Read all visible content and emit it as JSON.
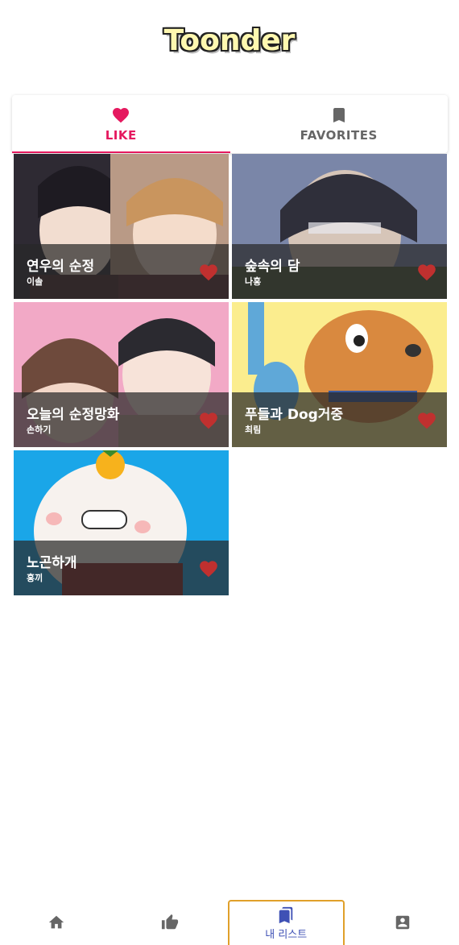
{
  "app": {
    "logo_text": "Toonder"
  },
  "tabs": [
    {
      "label": "LIKE",
      "icon": "heart-icon",
      "active": true
    },
    {
      "label": "FAVORITES",
      "icon": "bookmark-icon",
      "active": false
    }
  ],
  "colors": {
    "accent": "#e5195f",
    "heart": "#c0302f",
    "nav_active": "#3f51b5",
    "nav_border": "#e0a02a"
  },
  "cards": [
    {
      "title": "연우의 순정",
      "author": "이솔",
      "liked": true
    },
    {
      "title": "숲속의 담",
      "author": "나홍",
      "liked": true
    },
    {
      "title": "오늘의 순정망화",
      "author": "손하기",
      "liked": true
    },
    {
      "title": "푸들과 Dog거중",
      "author": "최림",
      "liked": true
    },
    {
      "title": "노곤하개",
      "author": "홍끼",
      "liked": true
    }
  ],
  "bottom_nav": [
    {
      "name": "home",
      "icon": "home-icon",
      "label": ""
    },
    {
      "name": "recommend",
      "icon": "thumb-up-icon",
      "label": ""
    },
    {
      "name": "my-list",
      "icon": "bookmarks-icon",
      "label": "내 리스트",
      "active": true
    },
    {
      "name": "profile",
      "icon": "account-box-icon",
      "label": ""
    }
  ]
}
